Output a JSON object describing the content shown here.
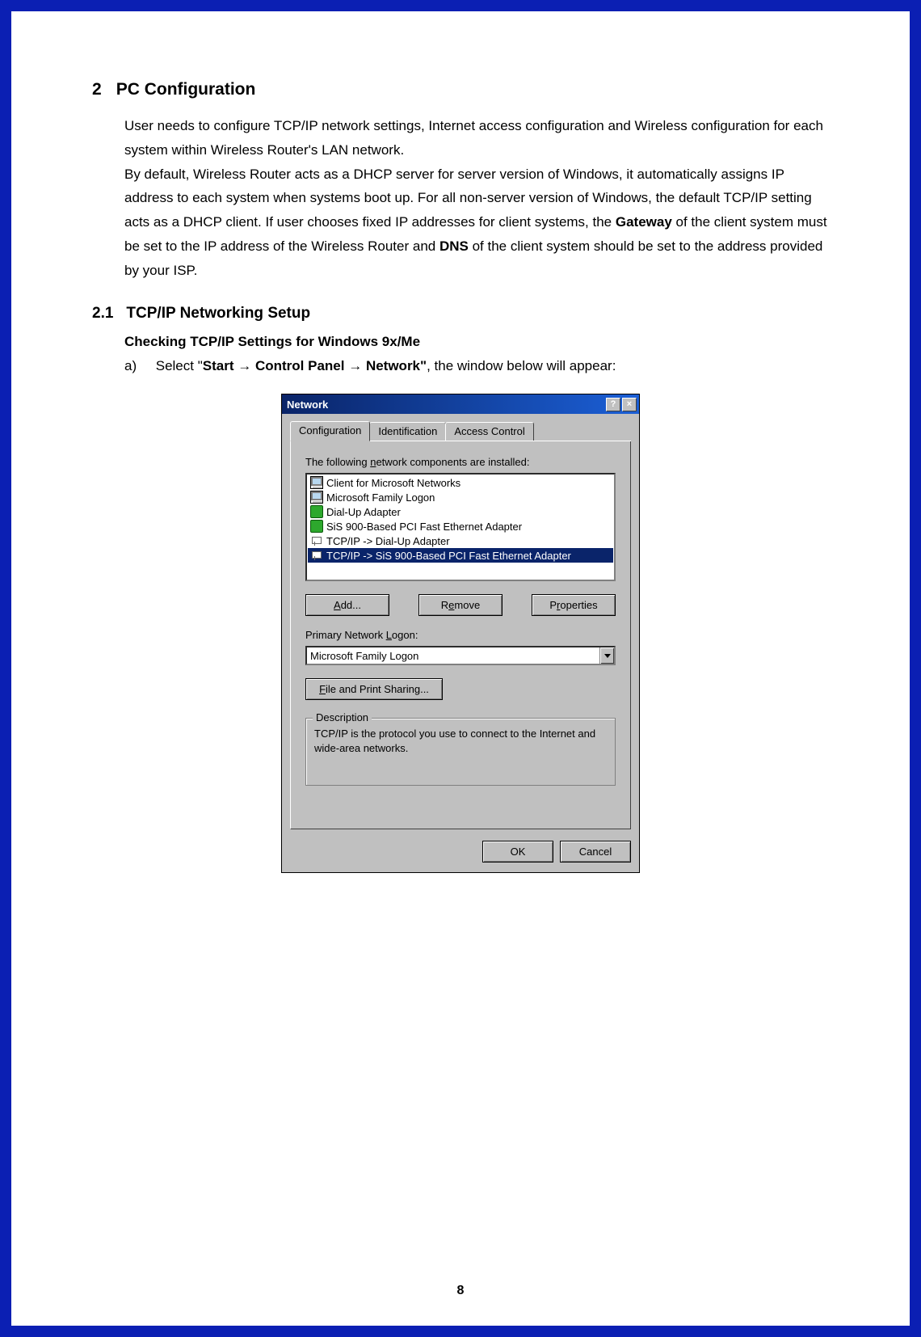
{
  "section": {
    "num": "2",
    "title": "PC Configuration"
  },
  "para1_p1": "User needs to configure TCP/IP network settings, Internet access configuration and Wireless configuration for each system within Wireless Router's LAN network.",
  "para1_p2a": "By default, Wireless Router acts as a DHCP server for server version of Windows, it automatically assigns IP address to each system when systems boot up.    For all non-server version of Windows, the default TCP/IP setting acts as a DHCP client.    If user chooses fixed IP addresses for client systems, the ",
  "para1_gateway": "Gateway",
  "para1_p2b": " of the client system must be set to the IP address of the Wireless Router and ",
  "para1_dns": "DNS",
  "para1_p2c": " of the client system should be set to the address provided by your ISP.",
  "subsection": {
    "num": "2.1",
    "title": "TCP/IP Networking Setup"
  },
  "subhead": "Checking TCP/IP Settings for Windows 9x/Me",
  "step_label": "a)",
  "step_pre": "Select \"",
  "step_nav": {
    "start": "Start",
    "arrow": "→",
    "cp": "Control Panel",
    "net": "Network\""
  },
  "step_post": ", the window below will appear:",
  "dialog": {
    "title": "Network",
    "help": "?",
    "close": "×",
    "tabs": [
      "Configuration",
      "Identification",
      "Access Control"
    ],
    "list_label_pre": "The following ",
    "list_label_u": "n",
    "list_label_post": "etwork components are installed:",
    "items": [
      {
        "icon": "computer",
        "text": "Client for Microsoft Networks"
      },
      {
        "icon": "computer",
        "text": "Microsoft Family Logon"
      },
      {
        "icon": "adapter",
        "text": "Dial-Up Adapter"
      },
      {
        "icon": "adapter",
        "text": "SiS 900-Based PCI Fast Ethernet Adapter"
      },
      {
        "icon": "tcp",
        "text": "TCP/IP -> Dial-Up Adapter"
      },
      {
        "icon": "tcp",
        "text": "TCP/IP -> SiS 900-Based PCI Fast Ethernet Adapter",
        "selected": true
      }
    ],
    "btn_add_u": "A",
    "btn_add_rest": "dd...",
    "btn_remove_pre": "R",
    "btn_remove_u": "e",
    "btn_remove_post": "move",
    "btn_props_pre": "P",
    "btn_props_u": "r",
    "btn_props_post": "operties",
    "primary_label_pre": "Primary Network ",
    "primary_label_u": "L",
    "primary_label_post": "ogon:",
    "primary_value": "Microsoft Family Logon",
    "fps_u": "F",
    "fps_rest": "ile and Print Sharing...",
    "group_title": "Description",
    "desc": "TCP/IP is the protocol you use to connect to the Internet and wide-area networks.",
    "ok": "OK",
    "cancel": "Cancel"
  },
  "page_num": "8"
}
